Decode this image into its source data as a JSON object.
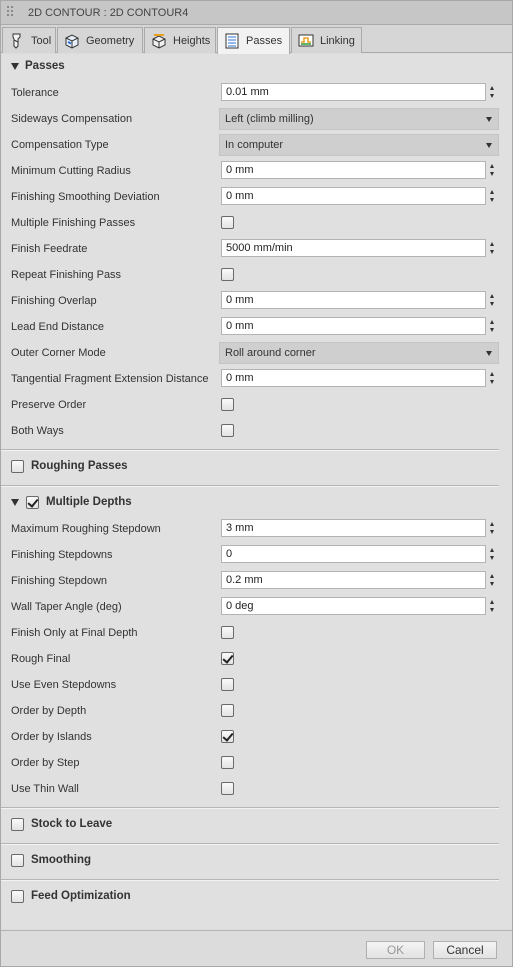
{
  "window": {
    "title": "2D CONTOUR : 2D CONTOUR4"
  },
  "tabs": [
    {
      "label": "Tool",
      "icon": "tool-icon"
    },
    {
      "label": "Geometry",
      "icon": "geometry-icon"
    },
    {
      "label": "Heights",
      "icon": "heights-icon"
    },
    {
      "label": "Passes",
      "icon": "passes-icon",
      "active": true
    },
    {
      "label": "Linking",
      "icon": "linking-icon"
    }
  ],
  "passes": {
    "title": "Passes",
    "tolerance": {
      "label": "Tolerance",
      "value": "0.01 mm"
    },
    "sideways_compensation": {
      "label": "Sideways Compensation",
      "value": "Left (climb milling)"
    },
    "compensation_type": {
      "label": "Compensation Type",
      "value": "In computer"
    },
    "minimum_cutting_radius": {
      "label": "Minimum Cutting Radius",
      "value": "0 mm"
    },
    "finishing_smoothing_deviation": {
      "label": "Finishing Smoothing Deviation",
      "value": "0 mm"
    },
    "multiple_finishing_passes": {
      "label": "Multiple Finishing Passes",
      "checked": false
    },
    "finish_feedrate": {
      "label": "Finish Feedrate",
      "value": "5000 mm/min"
    },
    "repeat_finishing_pass": {
      "label": "Repeat Finishing Pass",
      "checked": false
    },
    "finishing_overlap": {
      "label": "Finishing Overlap",
      "value": "0 mm"
    },
    "lead_end_distance": {
      "label": "Lead End Distance",
      "value": "0 mm"
    },
    "outer_corner_mode": {
      "label": "Outer Corner Mode",
      "value": "Roll around corner"
    },
    "tangential_fragment_extension_distance": {
      "label": "Tangential Fragment Extension Distance",
      "value": "0 mm"
    },
    "preserve_order": {
      "label": "Preserve Order",
      "checked": false
    },
    "both_ways": {
      "label": "Both Ways",
      "checked": false
    }
  },
  "roughing_passes": {
    "title": "Roughing Passes",
    "checked": false
  },
  "multiple_depths": {
    "title": "Multiple Depths",
    "checked": true,
    "maximum_roughing_stepdown": {
      "label": "Maximum Roughing Stepdown",
      "value": "3 mm"
    },
    "finishing_stepdowns": {
      "label": "Finishing Stepdowns",
      "value": "0"
    },
    "finishing_stepdown": {
      "label": "Finishing Stepdown",
      "value": "0.2 mm"
    },
    "wall_taper_angle": {
      "label": "Wall Taper Angle (deg)",
      "value": "0 deg"
    },
    "finish_only_at_final_depth": {
      "label": "Finish Only at Final Depth",
      "checked": false
    },
    "rough_final": {
      "label": "Rough Final",
      "checked": true
    },
    "use_even_stepdowns": {
      "label": "Use Even Stepdowns",
      "checked": false
    },
    "order_by_depth": {
      "label": "Order by Depth",
      "checked": false
    },
    "order_by_islands": {
      "label": "Order by Islands",
      "checked": true
    },
    "order_by_step": {
      "label": "Order by Step",
      "checked": false
    },
    "use_thin_wall": {
      "label": "Use Thin Wall",
      "checked": false
    }
  },
  "stock_to_leave": {
    "title": "Stock to Leave",
    "checked": false
  },
  "smoothing": {
    "title": "Smoothing",
    "checked": false
  },
  "feed_optimization": {
    "title": "Feed Optimization",
    "checked": false
  },
  "footer": {
    "ok_label": "OK",
    "cancel_label": "Cancel"
  }
}
